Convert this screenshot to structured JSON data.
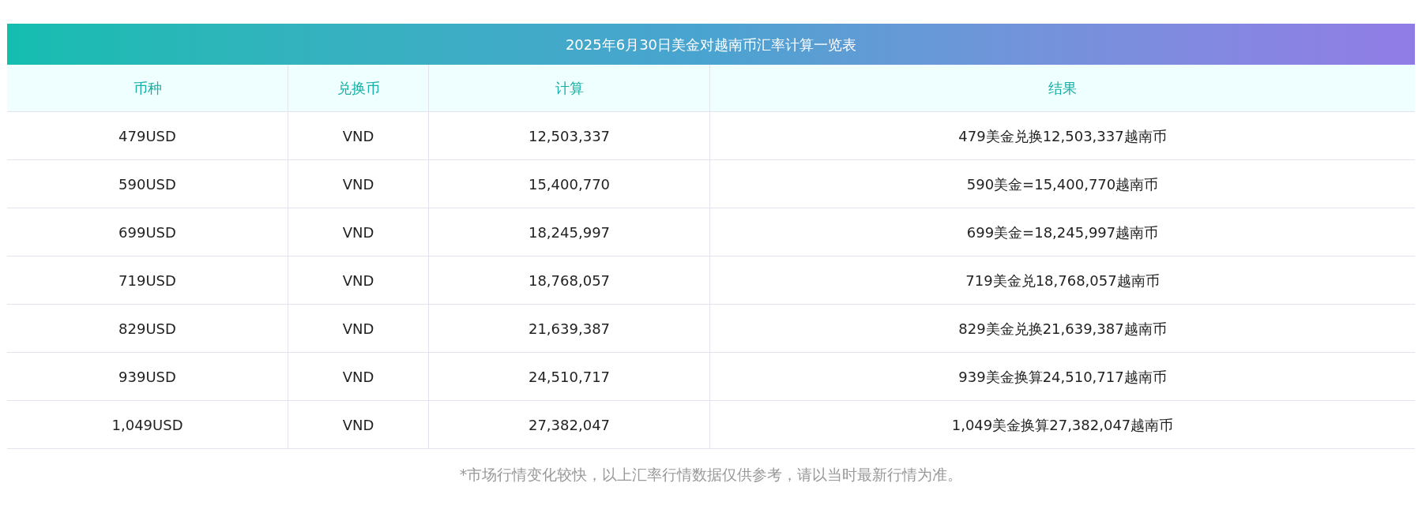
{
  "title": "2025年6月30日美金对越南币汇率计算一览表",
  "table": {
    "columns": [
      "币种",
      "兑换币",
      "计算",
      "结果"
    ],
    "rows": [
      [
        "479USD",
        "VND",
        "12,503,337",
        "479美金兑换12,503,337越南币"
      ],
      [
        "590USD",
        "VND",
        "15,400,770",
        "590美金=15,400,770越南币"
      ],
      [
        "699USD",
        "VND",
        "18,245,997",
        "699美金=18,245,997越南币"
      ],
      [
        "719USD",
        "VND",
        "18,768,057",
        "719美金兑18,768,057越南币"
      ],
      [
        "829USD",
        "VND",
        "21,639,387",
        "829美金兑换21,639,387越南币"
      ],
      [
        "939USD",
        "VND",
        "24,510,717",
        "939美金换算24,510,717越南币"
      ],
      [
        "1,049USD",
        "VND",
        "27,382,047",
        "1,049美金换算27,382,047越南币"
      ]
    ]
  },
  "footnote": "*市场行情变化较快，以上汇率行情数据仅供参考，请以当时最新行情为准。"
}
